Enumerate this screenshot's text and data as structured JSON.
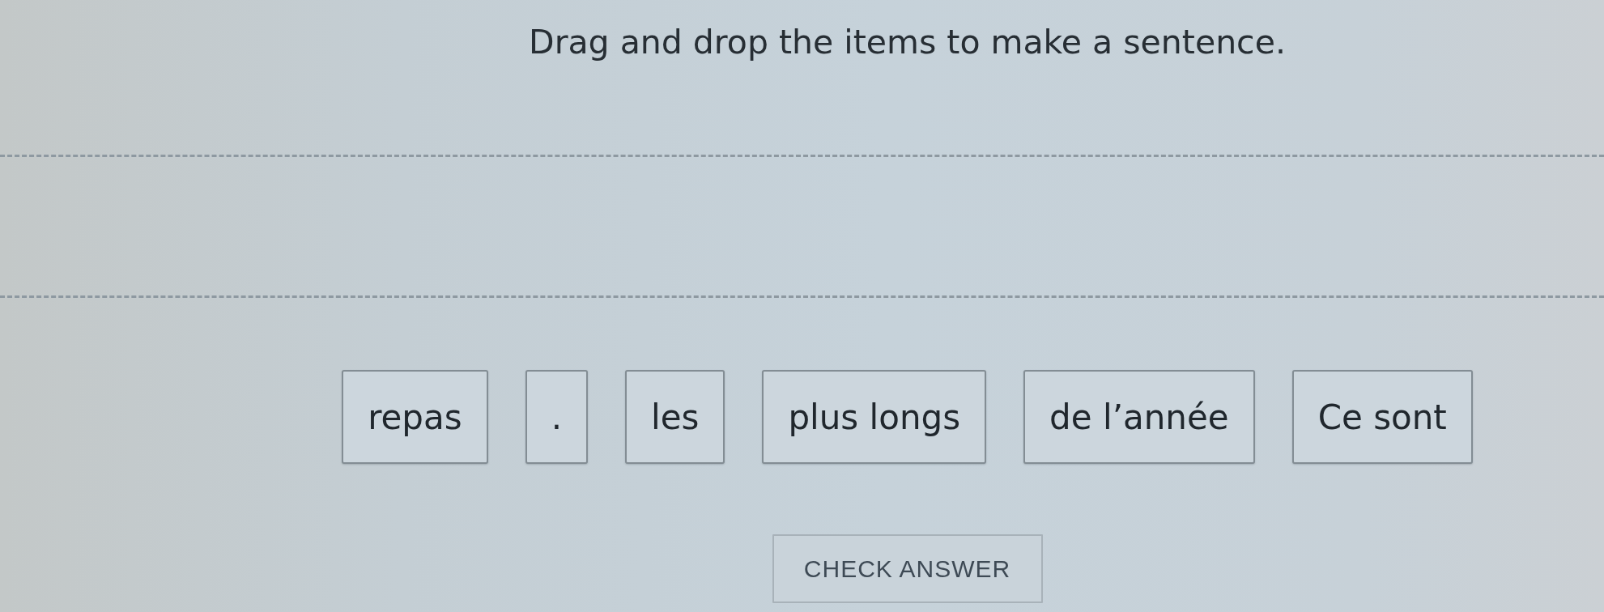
{
  "instruction": "Drag and drop the items to make a sentence.",
  "word_tiles": [
    {
      "text": "repas"
    },
    {
      "text": "."
    },
    {
      "text": "les"
    },
    {
      "text": "plus longs"
    },
    {
      "text": "de l’année"
    },
    {
      "text": "Ce sont"
    }
  ],
  "check_button": {
    "label": "CHECK ANSWER"
  }
}
